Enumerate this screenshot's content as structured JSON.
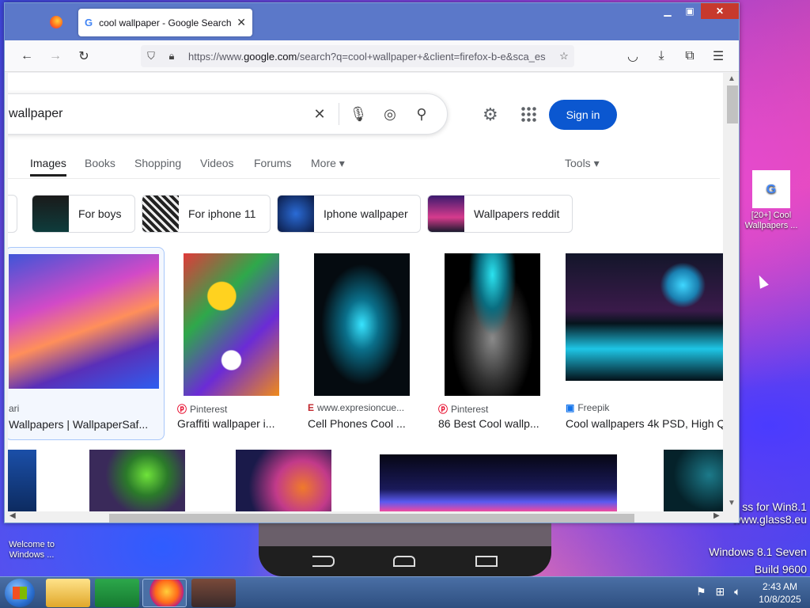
{
  "desktop": {
    "shortcut_label": "[20+] Cool Wallpapers ...",
    "welcome_label": "Welcome to Windows ...",
    "watermark_line1": "ss for Win8.1",
    "watermark_line2": "www.glass8.eu",
    "os_line1": "Windows 8.1 Seven",
    "os_line2": "Build 9600"
  },
  "browser": {
    "tab_title": "cool wallpaper - Google Search",
    "url_domain_prefix": "https://www.",
    "url_domain": "google.com",
    "url_path": "/search?q=cool+wallpaper+&client=firefox-b-e&sca_es"
  },
  "google": {
    "query": "wallpaper",
    "signin_label": "Sign in",
    "tabs": [
      "Images",
      "Books",
      "Shopping",
      "Videos",
      "Forums",
      "More ▾"
    ],
    "tools_label": "Tools ▾",
    "chips": [
      "For boys",
      "For iphone 11",
      "Iphone wallpaper",
      "Wallpapers reddit"
    ],
    "results": [
      {
        "source": "ari",
        "caption": "Wallpapers | WallpaperSaf..."
      },
      {
        "source": "Pinterest",
        "caption": "Graffiti wallpaper i..."
      },
      {
        "source": "www.expresioncue...",
        "caption": "Cell Phones Cool ..."
      },
      {
        "source": "Pinterest",
        "caption": "86 Best Cool wallp..."
      },
      {
        "source": "Freepik",
        "caption": "Cool wallpapers 4k PSD, High Q"
      }
    ]
  },
  "taskbar": {
    "time": "2:43 AM",
    "date": "10/8/2025"
  },
  "colors": {
    "accent": "#0b57d0",
    "close_button": "#c7392d",
    "tabbar": "#5b78c9"
  }
}
